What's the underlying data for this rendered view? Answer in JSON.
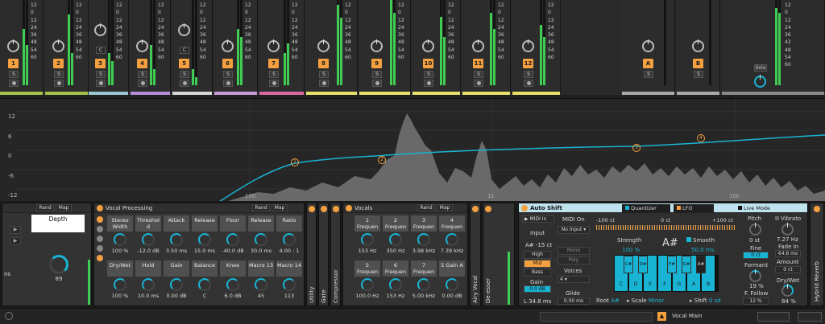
{
  "mixer": {
    "db_scale": [
      "12",
      "0",
      "12",
      "24",
      "36",
      "48",
      "54",
      "60"
    ],
    "db_scale_right": [
      "12",
      "0",
      "12",
      "24",
      "36",
      "42",
      "48",
      "54",
      "60"
    ],
    "tracks": [
      {
        "label": "1",
        "color": "#a6c14a"
      },
      {
        "label": "2",
        "color": "#a6c14a"
      },
      {
        "label": "3",
        "color": "#9bc8d0",
        "badge": "C"
      },
      {
        "label": "4",
        "color": "#b58bd8"
      },
      {
        "label": "5",
        "color": "#d6d6d6",
        "badge": "C"
      },
      {
        "label": "6",
        "color": "#c79bd9"
      },
      {
        "label": "7",
        "color": "#d96aa0"
      },
      {
        "label": "8",
        "color": "#e6e06a"
      },
      {
        "label": "9",
        "color": "#e6e06a"
      },
      {
        "label": "10",
        "color": "#e6e06a"
      },
      {
        "label": "11",
        "color": "#e6e06a"
      },
      {
        "label": "12",
        "color": "#e6e06a"
      }
    ],
    "returns": [
      {
        "label": "A",
        "color": "#a9a9a9"
      },
      {
        "label": "B",
        "color": "#a9a9a9"
      }
    ],
    "solo_label": "S",
    "master_solo": "Solo"
  },
  "eq": {
    "y_labels": [
      "12",
      "6",
      "0",
      "-6",
      "-12"
    ],
    "freq_labels": [
      "100",
      "1k",
      "10k"
    ],
    "bands": [
      "1",
      "2",
      "3",
      "4"
    ]
  },
  "rack": {
    "rand": "Rand",
    "map": "Map",
    "depth_label": "Depth",
    "depth_value": "89",
    "side_label": "ns"
  },
  "vocal_processing": {
    "title": "Vocal Processing",
    "rand": "Rand",
    "map": "Map",
    "macros": [
      {
        "label": "Stereo Width",
        "value": "100 %"
      },
      {
        "label": "Threshol d",
        "value": "-12.0 dB"
      },
      {
        "label": "Attack",
        "value": "3.50 ms"
      },
      {
        "label": "Release",
        "value": "15.0 ms"
      },
      {
        "label": "Floor",
        "value": "-40.0 dB"
      },
      {
        "label": "Release",
        "value": "30.0 ms"
      },
      {
        "label": "Ratio",
        "value": "4.00 : 1"
      },
      {
        "label": "Dry/Wet",
        "value": "100 %"
      },
      {
        "label": "Hold",
        "value": "10.0 ms"
      },
      {
        "label": "Gain",
        "value": "0.00 dB"
      },
      {
        "label": "Balance",
        "value": "C"
      },
      {
        "label": "Knee",
        "value": "6.0 dB"
      },
      {
        "label": "Macro 13",
        "value": "45"
      },
      {
        "label": "Macro 14",
        "value": "113"
      }
    ]
  },
  "collapsed_devices": [
    "Utility",
    "Gate",
    "Compressor"
  ],
  "vocals": {
    "title": "Vocals",
    "rand": "Rand",
    "map": "Map",
    "macros": [
      {
        "label": "1 Frequen",
        "value": "153 Hz"
      },
      {
        "label": "2 Frequen",
        "value": "350 Hz"
      },
      {
        "label": "3 Frequen",
        "value": "3.98 kHz"
      },
      {
        "label": "4 Frequen",
        "value": "7.39 kHz"
      },
      {
        "label": "5 Frequen",
        "value": "100.0 Hz"
      },
      {
        "label": "6 Frequen",
        "value": "153 Hz"
      },
      {
        "label": "7 Frequen",
        "value": "5.00 kHz"
      },
      {
        "label": "5 Gain A",
        "value": "0.00 dB"
      }
    ]
  },
  "collapsed_devices_2": [
    "Airy Vocal",
    "De-esser"
  ],
  "auto_shift": {
    "title": "Auto Shift",
    "midi_in": "MIDI In",
    "midi_on": "MIDI On",
    "no_input": "No Input",
    "input_label": "Input",
    "input_value": "A# -15 ct",
    "ranges": [
      "High",
      "Mid",
      "Bass"
    ],
    "active_range": "Mid",
    "gain_label": "Gain",
    "gain_value": "0.0 dB",
    "latency": "L 34.8 ms",
    "mono": "Mono",
    "poly": "Poly",
    "voices_label": "Voices",
    "voices_value": "4",
    "glide_label": "Glide",
    "glide_value": "0.00 ms",
    "tab_quantizer": "Quantizer",
    "tab_lfo": "LFO",
    "live_mode": "Live Mode",
    "ruler": [
      "-100 ct",
      "0 ct",
      "+100 ct"
    ],
    "strength_label": "Strength",
    "strength_value": "100 %",
    "detected_note": "A#",
    "smooth_label": "Smooth",
    "smooth_value": "50.0 ms",
    "black_keys": [
      "C#",
      "D#",
      "F#",
      "G#",
      "A#"
    ],
    "white_keys": [
      "C",
      "D",
      "E",
      "F",
      "G",
      "A",
      "B"
    ],
    "root_label": "Root",
    "root_value": "A#",
    "scale_label": "Scale",
    "scale_value": "Minor",
    "shift_label": "Shift",
    "shift_value": "0 sd",
    "pitch_label": "Pitch",
    "pitch_value": "0 st",
    "fine_label": "Fine",
    "fine_value": "0 ct",
    "formant_label": "Formant",
    "formant_value": "19 %",
    "ffollow_label": "F. Follow",
    "ffollow_value": "12 %",
    "vibrato_label": "Vibrato",
    "vibrato_value": "7.27 Hz",
    "fadein_label": "Fade In",
    "fadein_value": "64.6 ms",
    "amount_label": "Amount",
    "amount_value": "0 ct",
    "drywet_label": "Dry/Wet",
    "drywet_value": "84 %"
  },
  "hybrid_reverb": "Hybrid Reverb",
  "status": {
    "track_name": "Vocal Main"
  },
  "colors": {
    "accent": "#f5a040",
    "cyan": "#19b4d4",
    "meter": "#3fcc52"
  }
}
